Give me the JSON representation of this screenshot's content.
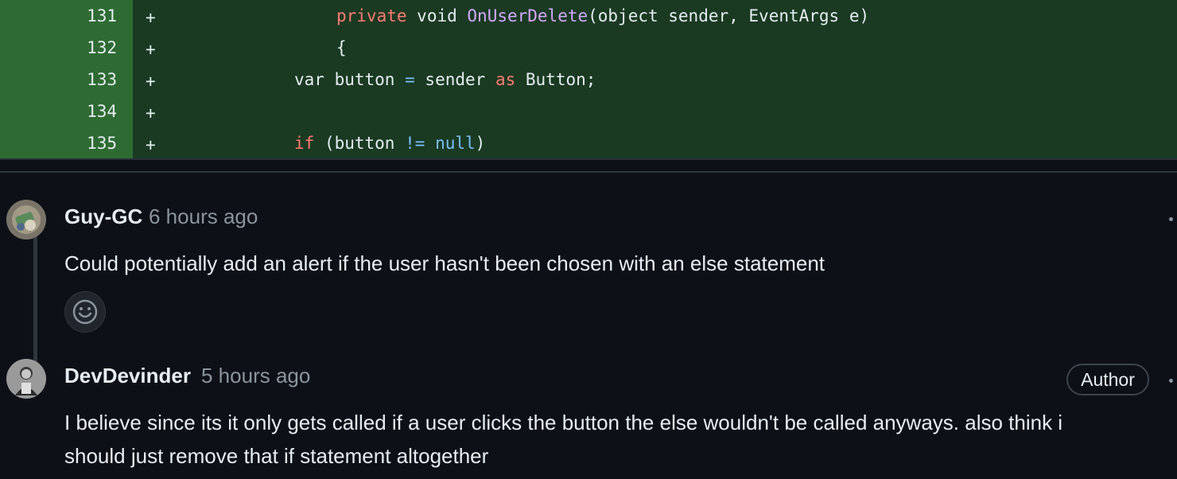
{
  "diff": {
    "lines": [
      {
        "num": "131",
        "marker": "+"
      },
      {
        "num": "132",
        "marker": "+"
      },
      {
        "num": "133",
        "marker": "+"
      },
      {
        "num": "134",
        "marker": "+"
      },
      {
        "num": "135",
        "marker": "+"
      }
    ],
    "code": {
      "l131": {
        "kw1": "private",
        "kw2": "void",
        "fn": "OnUserDelete",
        "rest": "(object sender, EventArgs e)"
      },
      "l132": {
        "text": "{"
      },
      "l133": {
        "kw1": "var",
        "ident": "button",
        "op": "=",
        "ident2": "sender",
        "kw2": "as",
        "rest": "Button;"
      },
      "l134": {
        "text": ""
      },
      "l135": {
        "kw1": "if",
        "p1": "(button",
        "op": "!=",
        "lit": "null",
        "p2": ")"
      }
    }
  },
  "comments": [
    {
      "author": "Guy-GC",
      "time": "6 hours ago",
      "body": "Could potentially add an alert if the user hasn't been chosen with an else statement",
      "avatar_icon": "avatar-image"
    },
    {
      "author": "DevDevinder",
      "time": "5 hours ago",
      "badge": "Author",
      "body_line1": "I believe since its it only gets called if a user clicks the button the else wouldn't be called anyways. also think i",
      "body_line2": "should just remove that if statement altogether",
      "avatar_icon": "avatar-image"
    }
  ],
  "reaction_icon": "smiley-icon",
  "colors": {
    "background": "#0d1117",
    "diff_added_bg": "#1a3a22",
    "diff_added_gutter": "#2e6b32",
    "keyword": "#ff7b72",
    "function": "#d2a8ff",
    "operator": "#79c0ff",
    "muted": "#8b949e"
  }
}
